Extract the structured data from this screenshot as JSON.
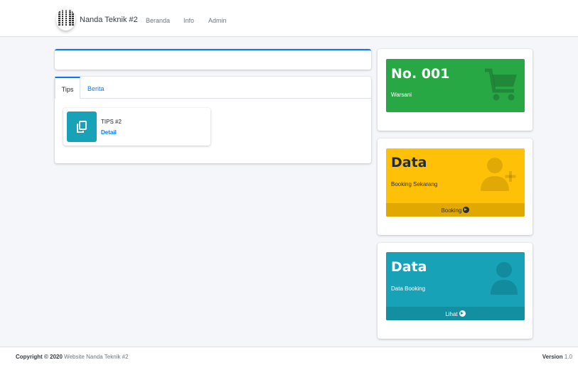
{
  "navbar": {
    "brand": "Nanda Teknik #2",
    "links": [
      "Beranda",
      "Info",
      "Admin"
    ]
  },
  "tabs": {
    "items": [
      "Tips",
      "Berita"
    ],
    "active": "Tips"
  },
  "tip_card": {
    "icon": "copy-icon",
    "title": "TIPS #2",
    "link": "Detail"
  },
  "boxes": {
    "queue": {
      "title": "No. 001",
      "subtitle": "Warsani",
      "icon": "cart-icon",
      "color": "#28a745"
    },
    "booking": {
      "title": "Data",
      "subtitle": "Booking Sekarang",
      "footer": "Booking",
      "icon": "user-plus-icon",
      "color": "#ffc107"
    },
    "data": {
      "title": "Data",
      "subtitle": "Data Booking",
      "footer": "Lihat",
      "icon": "user-icon",
      "color": "#17a2b8"
    }
  },
  "footer": {
    "copyright_bold": "Copyright © 2020",
    "copyright_rest": "Website Nanda Teknik #2",
    "version_label": "Version",
    "version_number": "1.0"
  }
}
